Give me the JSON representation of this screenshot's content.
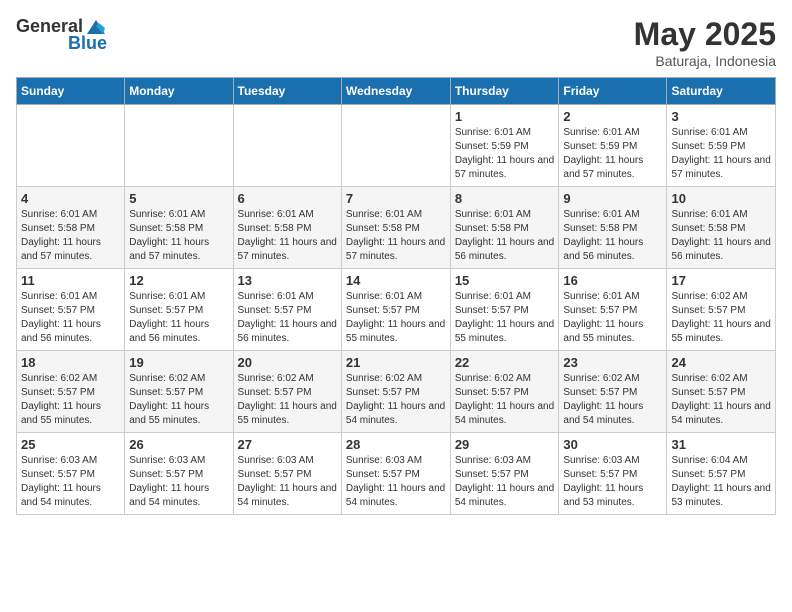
{
  "logo": {
    "general": "General",
    "blue": "Blue"
  },
  "title": {
    "month_year": "May 2025",
    "location": "Baturaja, Indonesia"
  },
  "headers": [
    "Sunday",
    "Monday",
    "Tuesday",
    "Wednesday",
    "Thursday",
    "Friday",
    "Saturday"
  ],
  "weeks": [
    [
      {
        "day": "",
        "sunrise": "",
        "sunset": "",
        "daylight": ""
      },
      {
        "day": "",
        "sunrise": "",
        "sunset": "",
        "daylight": ""
      },
      {
        "day": "",
        "sunrise": "",
        "sunset": "",
        "daylight": ""
      },
      {
        "day": "",
        "sunrise": "",
        "sunset": "",
        "daylight": ""
      },
      {
        "day": "1",
        "sunrise": "6:01 AM",
        "sunset": "5:59 PM",
        "daylight": "11 hours and 57 minutes."
      },
      {
        "day": "2",
        "sunrise": "6:01 AM",
        "sunset": "5:59 PM",
        "daylight": "11 hours and 57 minutes."
      },
      {
        "day": "3",
        "sunrise": "6:01 AM",
        "sunset": "5:59 PM",
        "daylight": "11 hours and 57 minutes."
      }
    ],
    [
      {
        "day": "4",
        "sunrise": "6:01 AM",
        "sunset": "5:58 PM",
        "daylight": "11 hours and 57 minutes."
      },
      {
        "day": "5",
        "sunrise": "6:01 AM",
        "sunset": "5:58 PM",
        "daylight": "11 hours and 57 minutes."
      },
      {
        "day": "6",
        "sunrise": "6:01 AM",
        "sunset": "5:58 PM",
        "daylight": "11 hours and 57 minutes."
      },
      {
        "day": "7",
        "sunrise": "6:01 AM",
        "sunset": "5:58 PM",
        "daylight": "11 hours and 57 minutes."
      },
      {
        "day": "8",
        "sunrise": "6:01 AM",
        "sunset": "5:58 PM",
        "daylight": "11 hours and 56 minutes."
      },
      {
        "day": "9",
        "sunrise": "6:01 AM",
        "sunset": "5:58 PM",
        "daylight": "11 hours and 56 minutes."
      },
      {
        "day": "10",
        "sunrise": "6:01 AM",
        "sunset": "5:58 PM",
        "daylight": "11 hours and 56 minutes."
      }
    ],
    [
      {
        "day": "11",
        "sunrise": "6:01 AM",
        "sunset": "5:57 PM",
        "daylight": "11 hours and 56 minutes."
      },
      {
        "day": "12",
        "sunrise": "6:01 AM",
        "sunset": "5:57 PM",
        "daylight": "11 hours and 56 minutes."
      },
      {
        "day": "13",
        "sunrise": "6:01 AM",
        "sunset": "5:57 PM",
        "daylight": "11 hours and 56 minutes."
      },
      {
        "day": "14",
        "sunrise": "6:01 AM",
        "sunset": "5:57 PM",
        "daylight": "11 hours and 55 minutes."
      },
      {
        "day": "15",
        "sunrise": "6:01 AM",
        "sunset": "5:57 PM",
        "daylight": "11 hours and 55 minutes."
      },
      {
        "day": "16",
        "sunrise": "6:01 AM",
        "sunset": "5:57 PM",
        "daylight": "11 hours and 55 minutes."
      },
      {
        "day": "17",
        "sunrise": "6:02 AM",
        "sunset": "5:57 PM",
        "daylight": "11 hours and 55 minutes."
      }
    ],
    [
      {
        "day": "18",
        "sunrise": "6:02 AM",
        "sunset": "5:57 PM",
        "daylight": "11 hours and 55 minutes."
      },
      {
        "day": "19",
        "sunrise": "6:02 AM",
        "sunset": "5:57 PM",
        "daylight": "11 hours and 55 minutes."
      },
      {
        "day": "20",
        "sunrise": "6:02 AM",
        "sunset": "5:57 PM",
        "daylight": "11 hours and 55 minutes."
      },
      {
        "day": "21",
        "sunrise": "6:02 AM",
        "sunset": "5:57 PM",
        "daylight": "11 hours and 54 minutes."
      },
      {
        "day": "22",
        "sunrise": "6:02 AM",
        "sunset": "5:57 PM",
        "daylight": "11 hours and 54 minutes."
      },
      {
        "day": "23",
        "sunrise": "6:02 AM",
        "sunset": "5:57 PM",
        "daylight": "11 hours and 54 minutes."
      },
      {
        "day": "24",
        "sunrise": "6:02 AM",
        "sunset": "5:57 PM",
        "daylight": "11 hours and 54 minutes."
      }
    ],
    [
      {
        "day": "25",
        "sunrise": "6:03 AM",
        "sunset": "5:57 PM",
        "daylight": "11 hours and 54 minutes."
      },
      {
        "day": "26",
        "sunrise": "6:03 AM",
        "sunset": "5:57 PM",
        "daylight": "11 hours and 54 minutes."
      },
      {
        "day": "27",
        "sunrise": "6:03 AM",
        "sunset": "5:57 PM",
        "daylight": "11 hours and 54 minutes."
      },
      {
        "day": "28",
        "sunrise": "6:03 AM",
        "sunset": "5:57 PM",
        "daylight": "11 hours and 54 minutes."
      },
      {
        "day": "29",
        "sunrise": "6:03 AM",
        "sunset": "5:57 PM",
        "daylight": "11 hours and 54 minutes."
      },
      {
        "day": "30",
        "sunrise": "6:03 AM",
        "sunset": "5:57 PM",
        "daylight": "11 hours and 53 minutes."
      },
      {
        "day": "31",
        "sunrise": "6:04 AM",
        "sunset": "5:57 PM",
        "daylight": "11 hours and 53 minutes."
      }
    ]
  ],
  "labels": {
    "sunrise": "Sunrise:",
    "sunset": "Sunset:",
    "daylight": "Daylight hours"
  }
}
